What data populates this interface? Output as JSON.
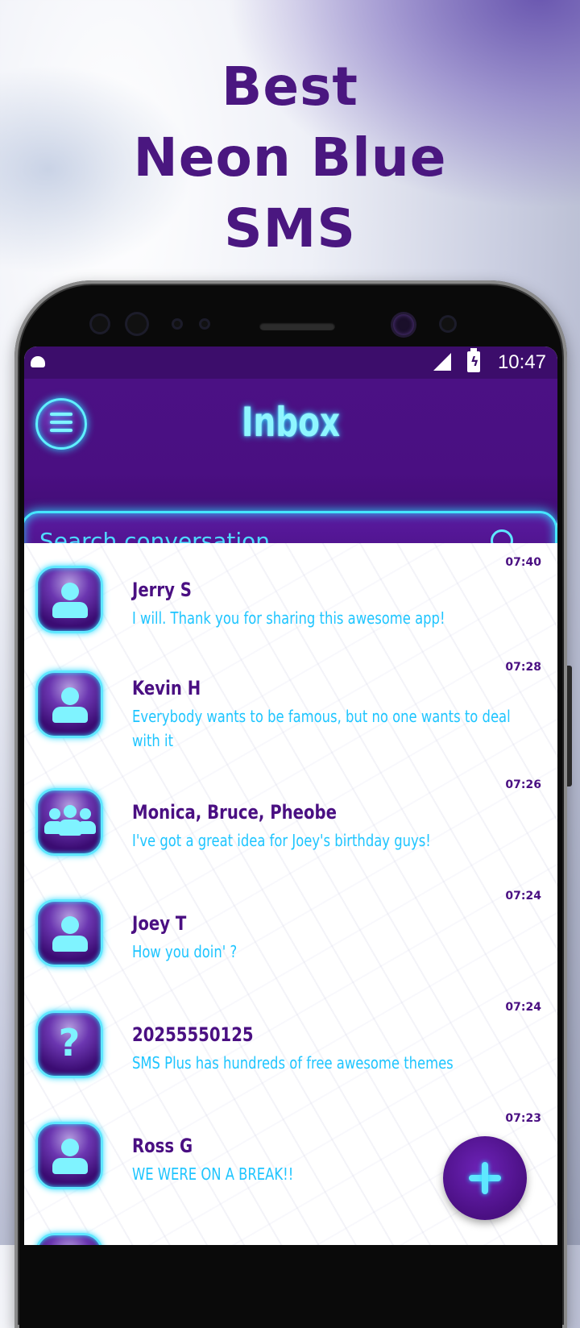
{
  "promo": {
    "headline_line1": "Best",
    "headline_line2": "Neon Blue",
    "headline_line3": "SMS"
  },
  "status_bar": {
    "time": "10:47"
  },
  "app_bar": {
    "title": "Inbox",
    "menu_icon": "hamburger-menu-icon"
  },
  "search": {
    "placeholder": "Search conversation",
    "icon": "search-icon"
  },
  "conversations": [
    {
      "name": "Jerry S",
      "message": "I will. Thank you for sharing this awesome app!",
      "time": "07:40",
      "avatar": "person-icon"
    },
    {
      "name": "Kevin H",
      "message": "Everybody wants to be famous, but no one wants to deal with it",
      "time": "07:28",
      "avatar": "person-icon"
    },
    {
      "name": "Monica, Bruce, Pheobe",
      "message": "I've got a great idea for Joey's birthday guys!",
      "time": "07:26",
      "avatar": "group-icon"
    },
    {
      "name": "Joey T",
      "message": "How you doin' ?",
      "time": "07:24",
      "avatar": "person-icon"
    },
    {
      "name": "20255550125",
      "message": "SMS Plus has hundreds of free awesome themes",
      "time": "07:24",
      "avatar": "question-icon"
    },
    {
      "name": "Ross G",
      "message": "WE WERE ON A BREAK!!",
      "time": "07:23",
      "avatar": "person-icon"
    }
  ],
  "fab": {
    "icon": "plus-icon"
  },
  "colors": {
    "accent_neon": "#5fe7ff",
    "primary_purple": "#4a0f82",
    "headline": "#4a1780"
  }
}
